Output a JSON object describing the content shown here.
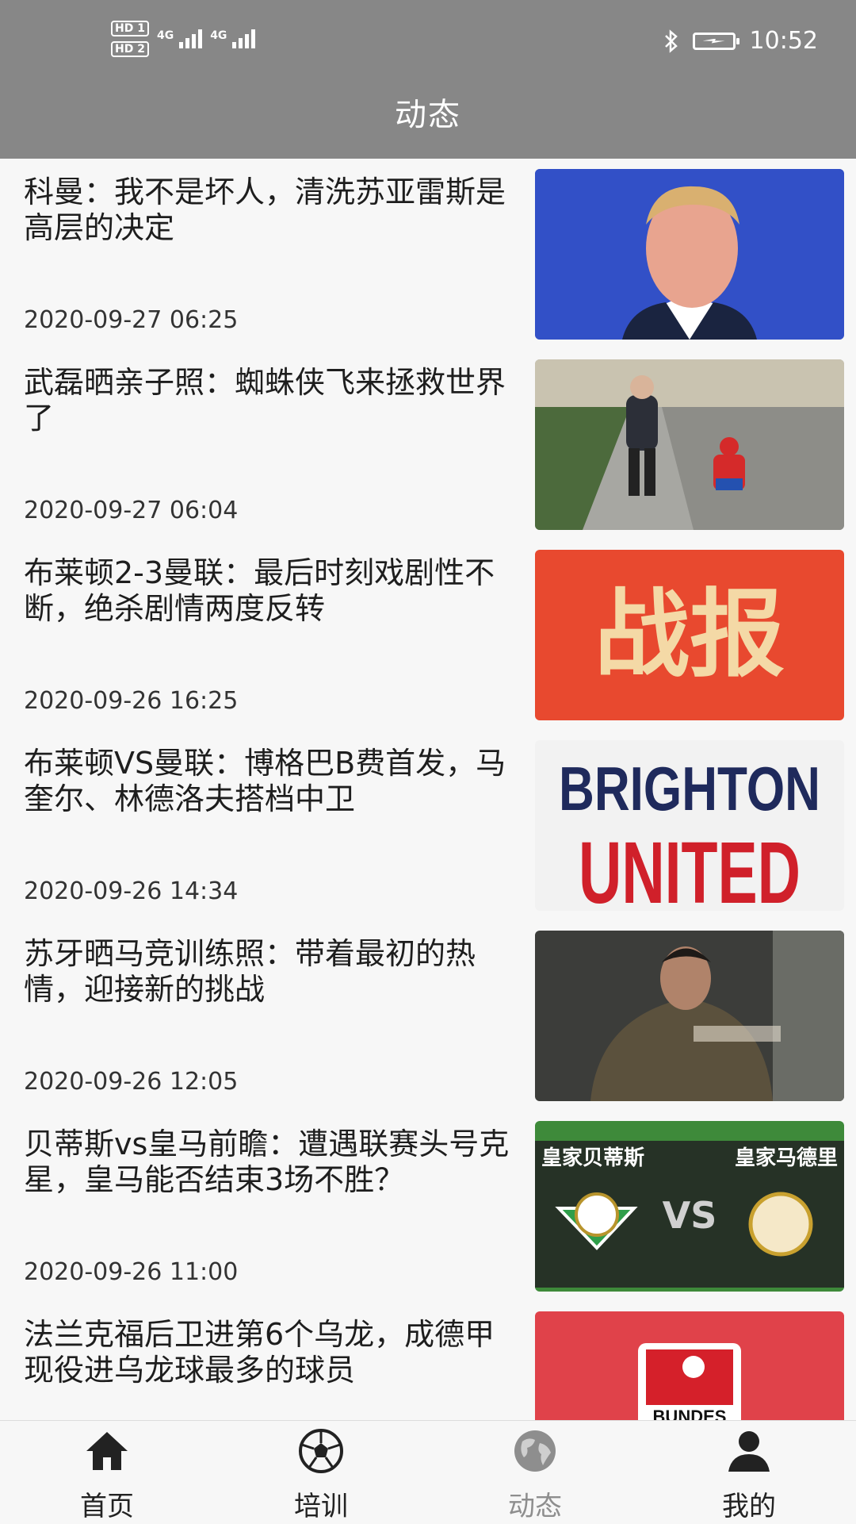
{
  "status_bar": {
    "sim1": "HD 1",
    "sim2": "HD 2",
    "net1": "4G",
    "net2": "4G",
    "time": "10:52",
    "icons": [
      "bluetooth-icon",
      "battery-charging-icon"
    ]
  },
  "header": {
    "title": "动态"
  },
  "news": [
    {
      "title": "科曼：我不是坏人，清洗苏亚雷斯是高层的决定",
      "time": "2020-09-27 06:25",
      "image": "koeman-press-photo"
    },
    {
      "title": "武磊晒亲子照：蜘蛛侠飞来拯救世界了",
      "time": "2020-09-27 06:04",
      "image": "street-walk-photo"
    },
    {
      "title": "布莱顿2-3曼联：最后时刻戏剧性不断，绝杀剧情两度反转",
      "time": "2020-09-26 16:25",
      "image": "zhanbao-poster",
      "image_text": "战报"
    },
    {
      "title": "布莱顿VS曼联：博格巴B费首发，马奎尔、林德洛夫搭档中卫",
      "time": "2020-09-26 14:34",
      "image": "brighton-united-poster",
      "image_text_top": "BRIGHTON",
      "image_text_bottom": "UNITED"
    },
    {
      "title": "苏牙晒马竞训练照：带着最初的热情，迎接新的挑战",
      "time": "2020-09-26 12:05",
      "image": "suarez-training-photo"
    },
    {
      "title": "贝蒂斯vs皇马前瞻：遭遇联赛头号克星，皇马能否结束3场不胜？",
      "time": "2020-09-26 11:00",
      "image": "betis-vs-madrid-poster",
      "image_left": "皇家贝蒂斯",
      "image_right": "皇家马德里",
      "image_vs": "VS"
    },
    {
      "title": "法兰克福后卫进第6个乌龙，成德甲现役进乌龙球最多的球员",
      "time": "",
      "image": "bundesliga-logo",
      "image_text": "BUNDES"
    }
  ],
  "bottom_nav": [
    {
      "label": "首页",
      "icon": "home-icon",
      "active": false
    },
    {
      "label": "培训",
      "icon": "soccer-ball-icon",
      "active": false
    },
    {
      "label": "动态",
      "icon": "globe-icon",
      "active": true
    },
    {
      "label": "我的",
      "icon": "user-icon",
      "active": false
    }
  ],
  "colors": {
    "header_bg": "#878787",
    "page_bg": "#f7f7f7",
    "active_tab": "#8e8e8e",
    "zhanbao_red": "#e8492f"
  }
}
